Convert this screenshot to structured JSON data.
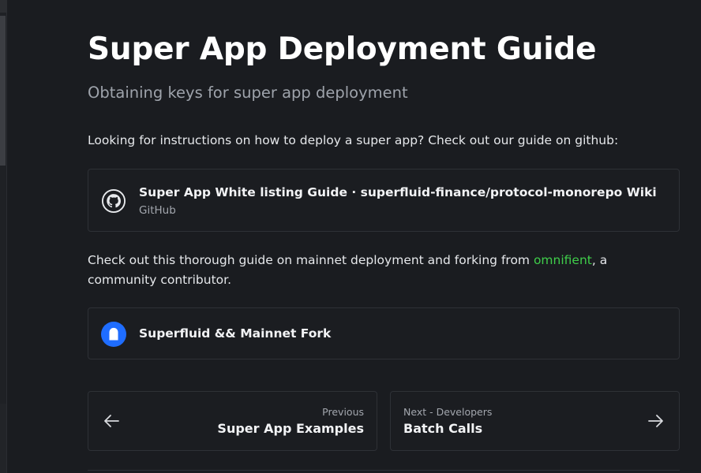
{
  "page": {
    "title": "Super App Deployment Guide",
    "subtitle": "Obtaining keys for super app deployment"
  },
  "intro_text": "Looking for instructions on how to deploy a super app? Check out our guide on github:",
  "github_card": {
    "title": "Super App White listing Guide · superfluid-finance/protocol-monorepo Wiki",
    "source": "GitHub",
    "icon": "github-icon"
  },
  "mainnet_text": {
    "before": "Check out this thorough guide on mainnet deployment and forking from ",
    "link": "omnifient",
    "after": ", a community contributor."
  },
  "fork_card": {
    "title": "Superfluid && Mainnet Fork",
    "icon": "superfluid-icon"
  },
  "pagination": {
    "prev_label": "Previous",
    "prev_title": "Super App Examples",
    "next_label": "Next - Developers",
    "next_title": "Batch Calls"
  },
  "colors": {
    "background": "#1a1c20",
    "link": "#3fcd4a",
    "accent_blue": "#1f6dff"
  }
}
